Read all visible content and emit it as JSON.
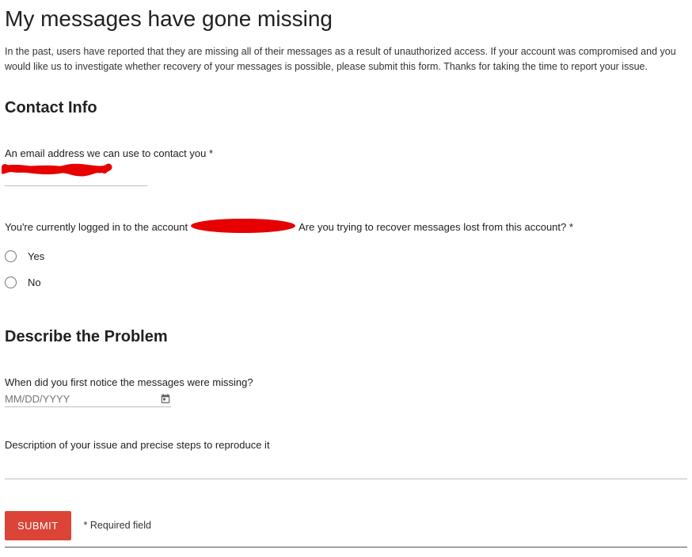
{
  "title": "My messages have gone missing",
  "intro": "In the past, users have reported that they are missing all of their messages as a result of unauthorized access. If your account was compromised and you would like us to investigate whether recovery of your messages is possible, please submit this form. Thanks for taking the time to report your issue.",
  "contact": {
    "heading": "Contact Info",
    "email_label": "An email address we can use to contact you *",
    "email_value_redacted": true,
    "login_prefix": "You're currently logged in to the account",
    "login_account_redacted": true,
    "login_suffix": "Are you trying to recover messages lost from this account? *",
    "options": {
      "yes": "Yes",
      "no": "No"
    }
  },
  "problem": {
    "heading": "Describe the Problem",
    "date_label": "When did you first notice the messages were missing?",
    "date_placeholder": "MM/DD/YYYY",
    "desc_label": "Description of your issue and precise steps to reproduce it"
  },
  "footer": {
    "submit": "SUBMIT",
    "required_note": "* Required field"
  }
}
